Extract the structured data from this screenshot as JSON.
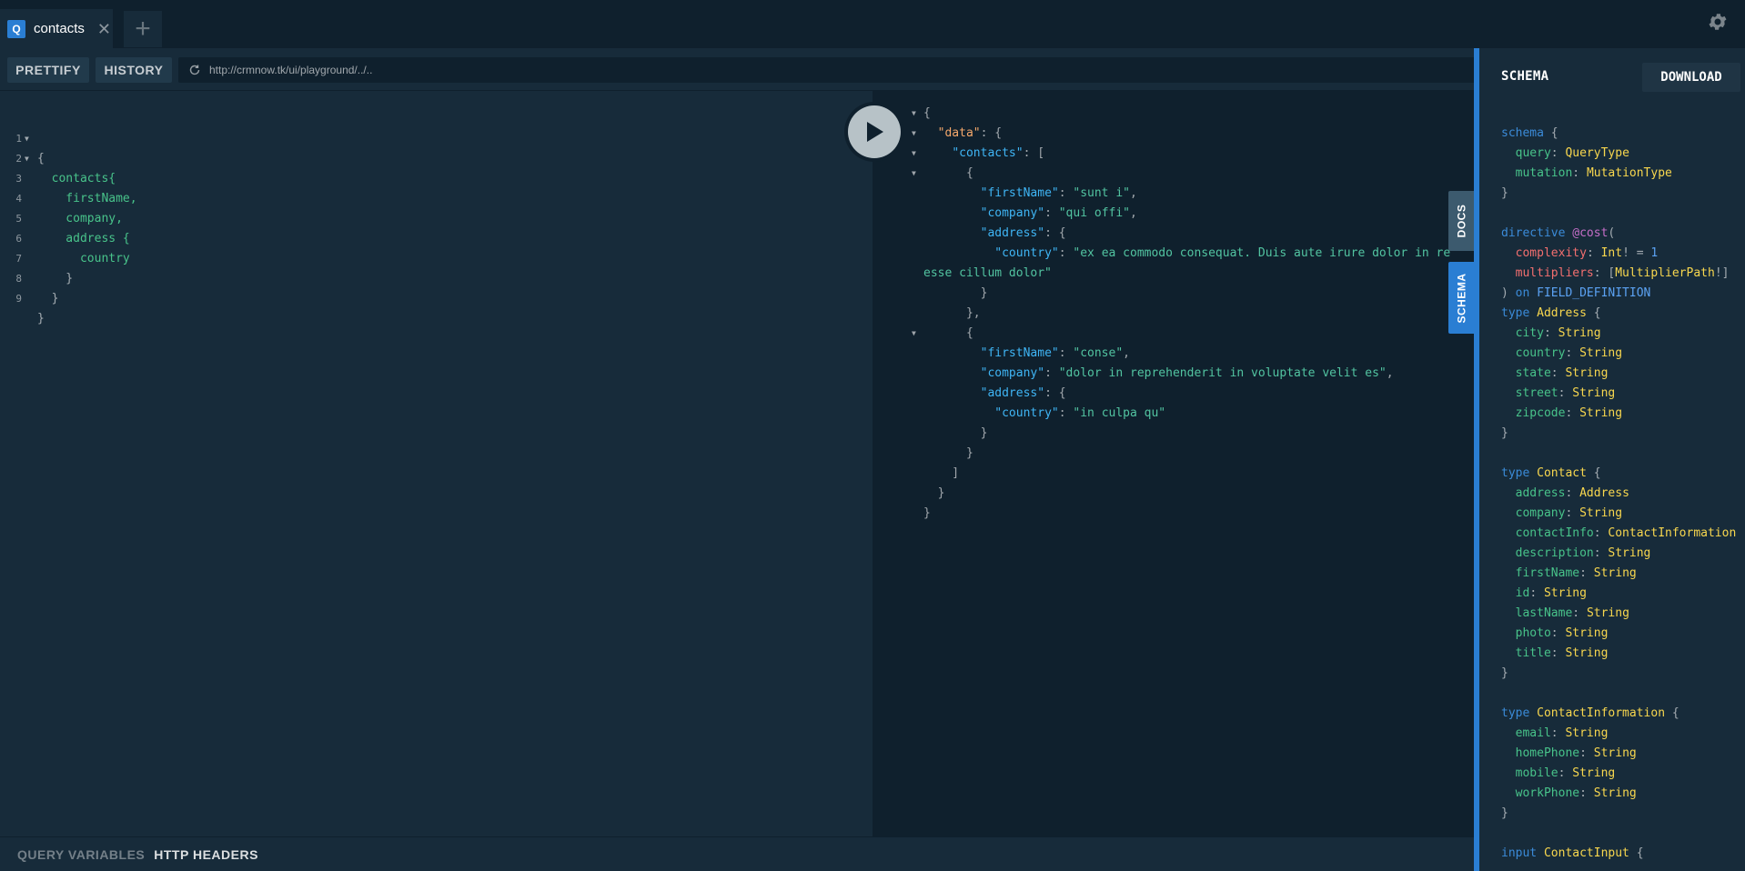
{
  "tabs": {
    "items": [
      {
        "badge": "Q",
        "label": "contacts",
        "close": "✕"
      }
    ],
    "add_label": "+"
  },
  "toolbar": {
    "prettify_label": "PRETTIFY",
    "history_label": "HISTORY",
    "endpoint_url": "http://crmnow.tk/ui/playground/../.."
  },
  "editor": {
    "lines": [
      {
        "num": "1",
        "text": "{"
      },
      {
        "num": "2",
        "text": "  contacts{"
      },
      {
        "num": "3",
        "text": "    firstName,"
      },
      {
        "num": "4",
        "text": "    company,"
      },
      {
        "num": "5",
        "text": "    address {"
      },
      {
        "num": "6",
        "text": "      country"
      },
      {
        "num": "7",
        "text": "    }"
      },
      {
        "num": "8",
        "text": "  }"
      },
      {
        "num": "9",
        "text": "}"
      }
    ]
  },
  "result": {
    "data_key": "\"data\"",
    "contacts_key": "\"contacts\"",
    "first_name_key": "\"firstName\"",
    "company_key": "\"company\"",
    "address_key": "\"address\"",
    "country_key": "\"country\"",
    "c1_first_name": "\"sunt i\"",
    "c1_company": "\"qui offi\"",
    "c1_country_part1": "\"ex ea commodo consequat. Duis aute irure dolor in re",
    "c1_country_part2": "esse cillum dolor\"",
    "c2_first_name": "\"conse\"",
    "c2_company": "\"dolor in reprehenderit in voluptate velit es\"",
    "c2_country": "\"in culpa qu\""
  },
  "side_tabs": {
    "docs_label": "DOCS",
    "schema_label": "SCHEMA"
  },
  "bottom": {
    "query_variables_label": "QUERY VARIABLES",
    "http_headers_label": "HTTP HEADERS"
  },
  "schema": {
    "title": "SCHEMA",
    "download_label": "DOWNLOAD",
    "schema_kw": "schema",
    "query_field": "query",
    "query_type": "QueryType",
    "mutation_field": "mutation",
    "mutation_type": "MutationType",
    "directive_kw": "directive",
    "directive_name": "@cost",
    "arg_complexity": "complexity",
    "int_type": "Int",
    "default_value": "1",
    "arg_multipliers": "multipliers",
    "multiplier_type": "MultiplierPath",
    "on_kw": "on",
    "field_definition": "FIELD_DEFINITION",
    "type_kw": "type",
    "input_kw": "input",
    "string_type": "String",
    "address_type": {
      "name": "Address",
      "fields": [
        "city",
        "country",
        "state",
        "street",
        "zipcode"
      ]
    },
    "contact_type": {
      "name": "Contact",
      "fields": [
        {
          "name": "address",
          "type": "Address"
        },
        {
          "name": "company",
          "type": "String"
        },
        {
          "name": "contactInfo",
          "type": "ContactInformation"
        },
        {
          "name": "description",
          "type": "String"
        },
        {
          "name": "firstName",
          "type": "String"
        },
        {
          "name": "id",
          "type": "String"
        },
        {
          "name": "lastName",
          "type": "String"
        },
        {
          "name": "photo",
          "type": "String"
        },
        {
          "name": "title",
          "type": "String"
        }
      ]
    },
    "contact_information_type": {
      "name": "ContactInformation",
      "fields": [
        "email",
        "homePhone",
        "mobile",
        "workPhone"
      ]
    },
    "contact_input": {
      "name": "ContactInput"
    }
  },
  "icons": {
    "settings": "gear-icon",
    "reload": "reload-icon",
    "play": "play-icon"
  },
  "colors": {
    "accent": "#2a7ed3",
    "background": "#172b3a",
    "dark_background": "#0f202d",
    "field": "#48c38a",
    "type_name": "#f8d74e",
    "keyword": "#3b8bd8",
    "json_key": "#3fb5f5",
    "json_string": "#52c4a1"
  }
}
